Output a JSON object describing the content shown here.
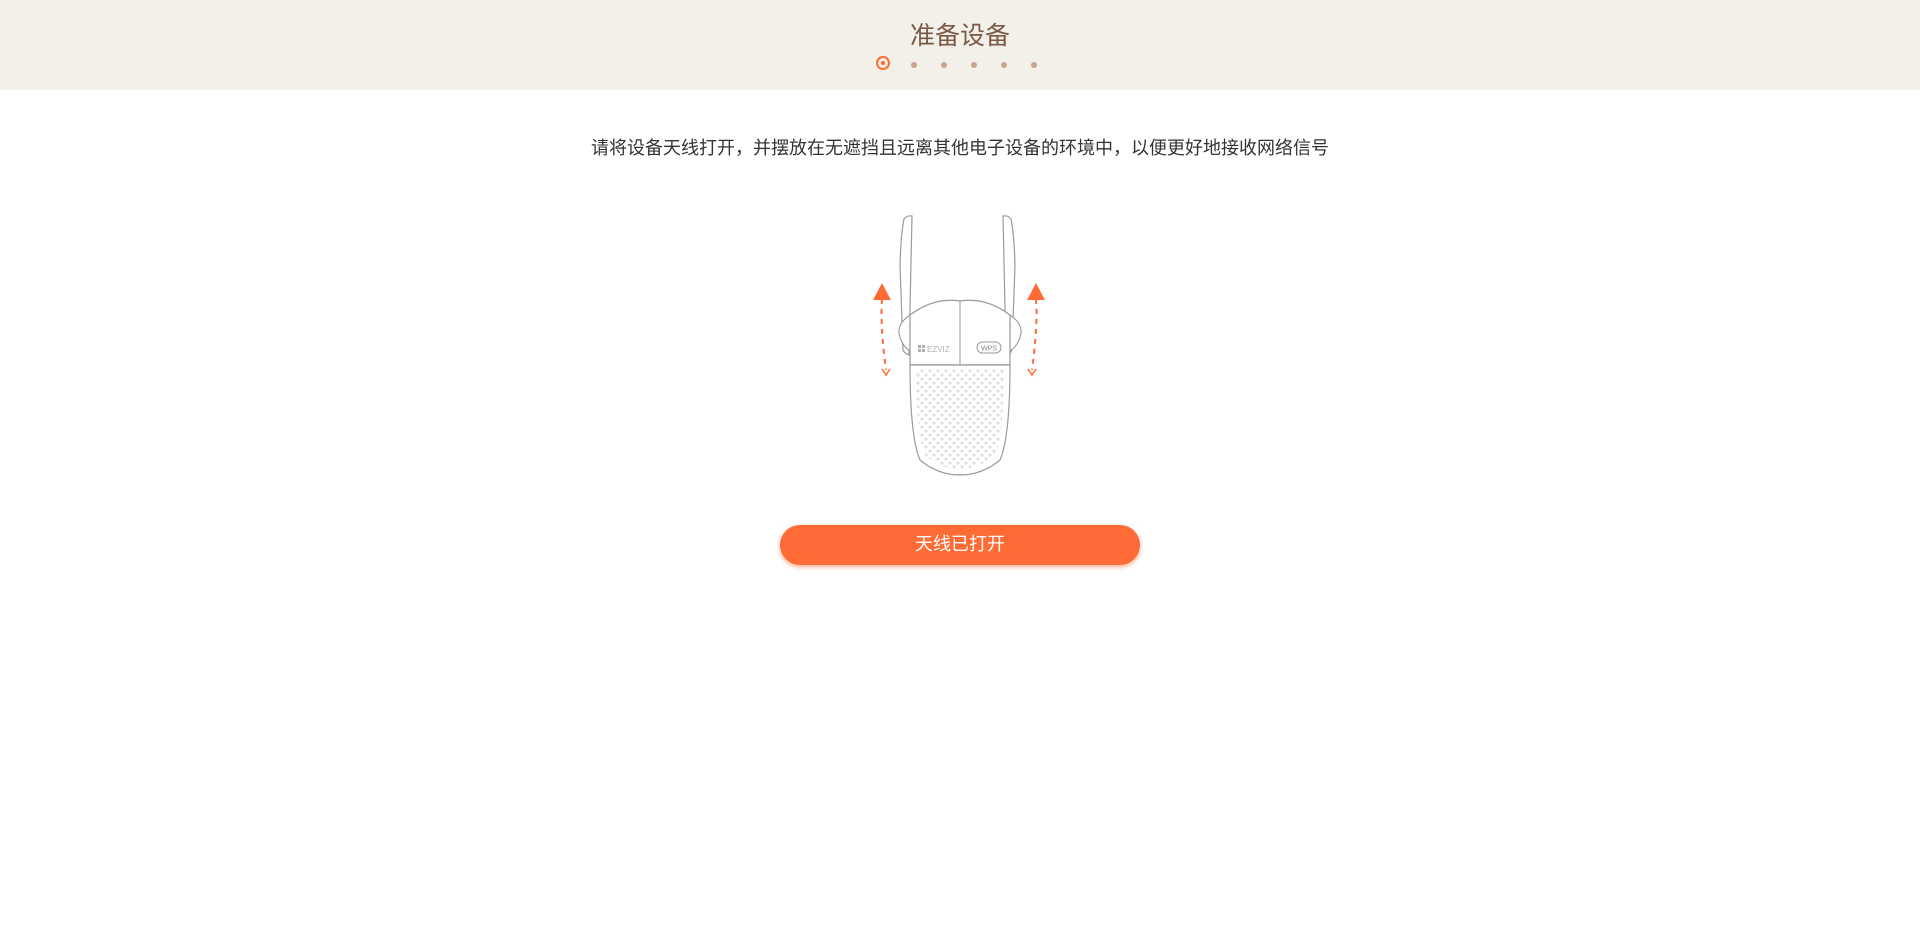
{
  "header": {
    "title": "准备设备",
    "steps": {
      "total": 6,
      "current": 1
    }
  },
  "main": {
    "instruction": "请将设备天线打开，并摆放在无遮挡且远离其他电子设备的环境中，以便更好地接收网络信号",
    "device_brand_label": "EZVIZ",
    "device_button_label": "WPS",
    "primary_button_label": "天线已打开"
  },
  "colors": {
    "accent": "#ff6b35",
    "header_bg": "#f3efe9",
    "title_text": "#7a5a44",
    "dot_inactive": "#c7a58f"
  },
  "icons": {
    "device": "wifi-repeater-device-illustration",
    "arrows": "arrow-up-dashed-icon"
  }
}
